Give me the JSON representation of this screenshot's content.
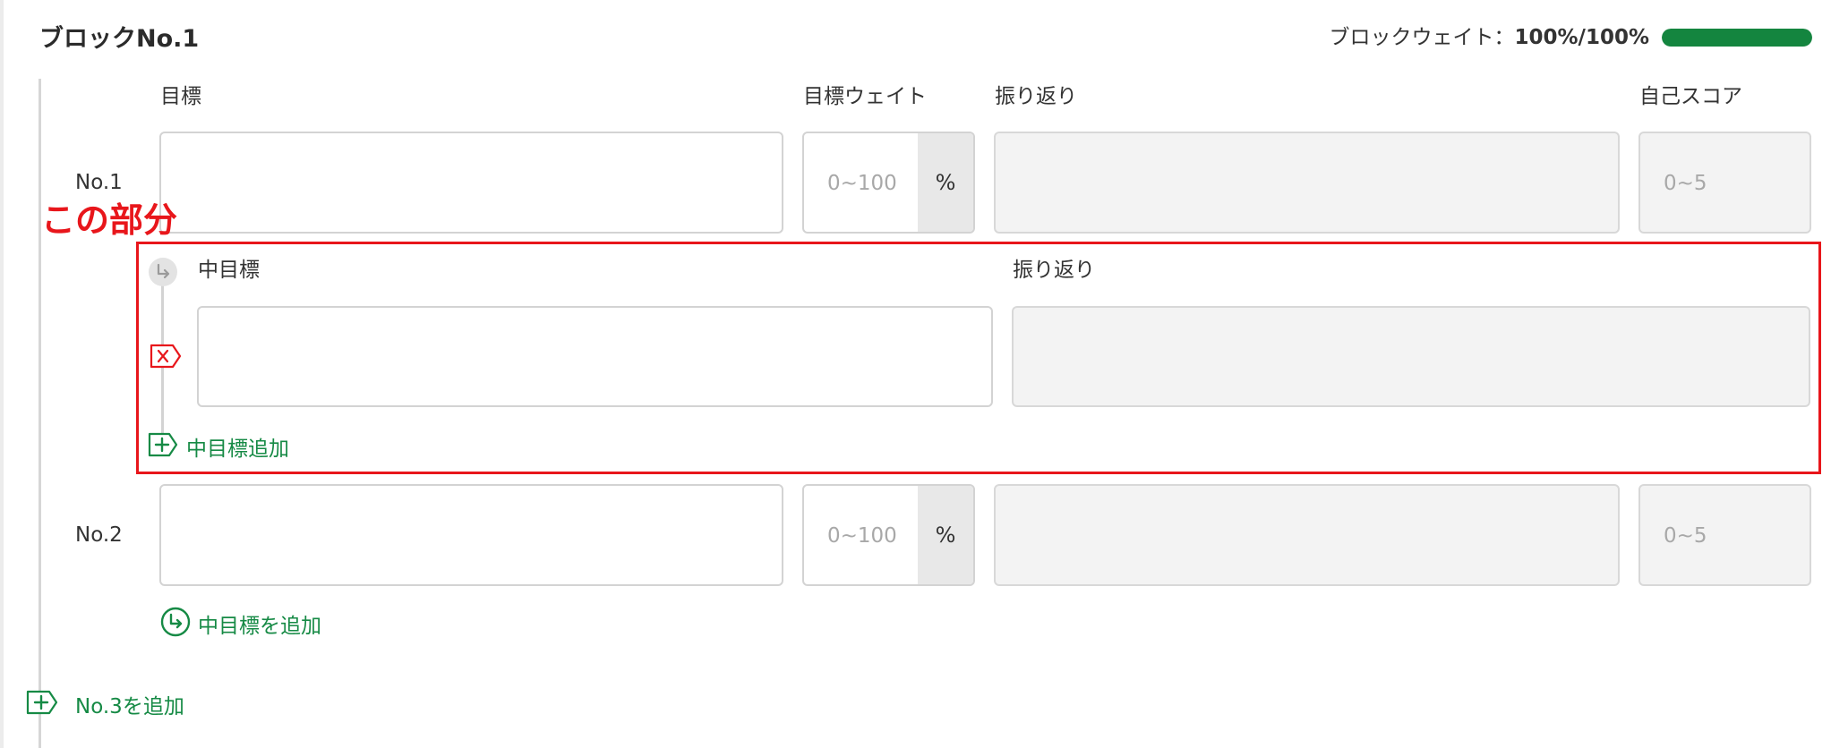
{
  "block": {
    "title": "ブロックNo.1",
    "weight_label": "ブロックウェイト：",
    "weight_value": "100%/100%",
    "weight_fraction": 1.0
  },
  "columns": {
    "goal": "目標",
    "goal_weight": "目標ウェイト",
    "reflection": "振り返り",
    "self_score": "自己スコア"
  },
  "rows": [
    {
      "label": "No.1",
      "goal_value": "",
      "weight_placeholder": "0~100",
      "weight_unit": "%",
      "reflection_value": "",
      "score_placeholder": "0~5"
    },
    {
      "label": "No.2",
      "goal_value": "",
      "weight_placeholder": "0~100",
      "weight_unit": "%",
      "reflection_value": "",
      "score_placeholder": "0~5"
    }
  ],
  "annotation": {
    "text": "この部分",
    "color": "#e8161b"
  },
  "sub_goal": {
    "header_goal": "中目標",
    "header_reflection": "振り返り",
    "add_label": "中目標追加"
  },
  "row2_add_sub_goal": "中目標を追加",
  "add_row_label": "No.3を追加",
  "colors": {
    "accent_green": "#168a45",
    "bar_fill": "#14853f",
    "delete_red": "#e8161b"
  }
}
